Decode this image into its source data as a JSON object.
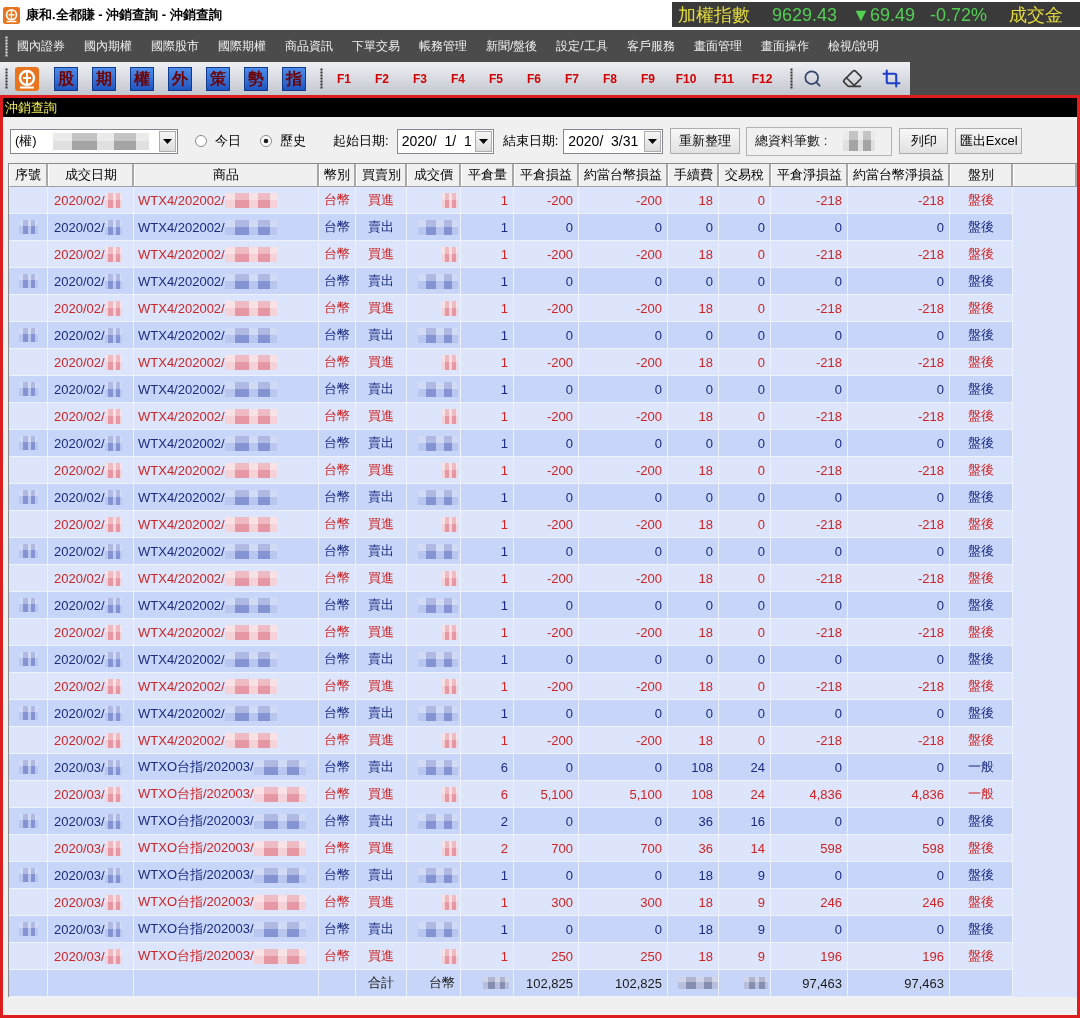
{
  "window": {
    "title": "康和.全都賺 - 沖銷查詢 - 沖銷查詢"
  },
  "ticker": {
    "label": "加權指數",
    "value": "9629.43",
    "change": "▼69.49",
    "percent": "-0.72%",
    "label_2": "成交金"
  },
  "menu": [
    "國內證券",
    "國內期權",
    "國際股市",
    "國際期權",
    "商品資訊",
    "下單交易",
    "帳務管理",
    "新聞/盤後",
    "設定/工具",
    "客戶服務",
    "畫面管理",
    "畫面操作",
    "檢視/說明"
  ],
  "toolbar": {
    "market_buttons": [
      "股",
      "期",
      "權",
      "外",
      "策",
      "勢",
      "指"
    ],
    "function_keys": [
      "F1",
      "F2",
      "F3",
      "F4",
      "F5",
      "F6",
      "F7",
      "F8",
      "F9",
      "F10",
      "F11",
      "F12"
    ]
  },
  "panel": {
    "title": "沖銷查詢"
  },
  "filters": {
    "account": "(權)",
    "range": [
      {
        "label": "今日",
        "selected": false
      },
      {
        "label": "歷史",
        "selected": true
      }
    ],
    "start_label": "起始日期:",
    "start_date": "2020/  1/  1",
    "end_label": "結束日期:",
    "end_date": "2020/  3/31",
    "refresh": "重新整理",
    "count_label": "總資料筆數 :",
    "buttons": [
      "列印",
      "匯出Excel"
    ]
  },
  "table": {
    "columns": [
      "序號",
      "成交日期",
      "商品",
      "幣別",
      "買賣別",
      "成交價",
      "平倉量",
      "平倉損益",
      "約當台幣損益",
      "手續費",
      "交易稅",
      "平倉淨損益",
      "約當台幣淨損益",
      "盤別"
    ],
    "rows": [
      {
        "kind": "buy",
        "seq_blurred": false,
        "date": "2020/02/",
        "product": "WTX4/202002/",
        "currency": "台幣",
        "side": "買進",
        "qty": "1",
        "pnl": "-200",
        "pnl_twd": "-200",
        "fee": "18",
        "tax": "0",
        "net": "-218",
        "net_twd": "-218",
        "session": "盤後"
      },
      {
        "kind": "sell",
        "seq_blurred": true,
        "date": "2020/02/",
        "product": "WTX4/202002/",
        "currency": "台幣",
        "side": "賣出",
        "qty": "1",
        "pnl": "0",
        "pnl_twd": "0",
        "fee": "0",
        "tax": "0",
        "net": "0",
        "net_twd": "0",
        "session": "盤後"
      },
      {
        "kind": "buy",
        "seq_blurred": false,
        "date": "2020/02/",
        "product": "WTX4/202002/",
        "currency": "台幣",
        "side": "買進",
        "qty": "1",
        "pnl": "-200",
        "pnl_twd": "-200",
        "fee": "18",
        "tax": "0",
        "net": "-218",
        "net_twd": "-218",
        "session": "盤後"
      },
      {
        "kind": "sell",
        "seq_blurred": true,
        "date": "2020/02/",
        "product": "WTX4/202002/",
        "currency": "台幣",
        "side": "賣出",
        "qty": "1",
        "pnl": "0",
        "pnl_twd": "0",
        "fee": "0",
        "tax": "0",
        "net": "0",
        "net_twd": "0",
        "session": "盤後"
      },
      {
        "kind": "buy",
        "seq_blurred": false,
        "date": "2020/02/",
        "product": "WTX4/202002/",
        "currency": "台幣",
        "side": "買進",
        "qty": "1",
        "pnl": "-200",
        "pnl_twd": "-200",
        "fee": "18",
        "tax": "0",
        "net": "-218",
        "net_twd": "-218",
        "session": "盤後"
      },
      {
        "kind": "sell",
        "seq_blurred": true,
        "date": "2020/02/",
        "product": "WTX4/202002/",
        "currency": "台幣",
        "side": "賣出",
        "qty": "1",
        "pnl": "0",
        "pnl_twd": "0",
        "fee": "0",
        "tax": "0",
        "net": "0",
        "net_twd": "0",
        "session": "盤後"
      },
      {
        "kind": "buy",
        "seq_blurred": false,
        "date": "2020/02/",
        "product": "WTX4/202002/",
        "currency": "台幣",
        "side": "買進",
        "qty": "1",
        "pnl": "-200",
        "pnl_twd": "-200",
        "fee": "18",
        "tax": "0",
        "net": "-218",
        "net_twd": "-218",
        "session": "盤後"
      },
      {
        "kind": "sell",
        "seq_blurred": true,
        "date": "2020/02/",
        "product": "WTX4/202002/",
        "currency": "台幣",
        "side": "賣出",
        "qty": "1",
        "pnl": "0",
        "pnl_twd": "0",
        "fee": "0",
        "tax": "0",
        "net": "0",
        "net_twd": "0",
        "session": "盤後"
      },
      {
        "kind": "buy",
        "seq_blurred": false,
        "date": "2020/02/",
        "product": "WTX4/202002/",
        "currency": "台幣",
        "side": "買進",
        "qty": "1",
        "pnl": "-200",
        "pnl_twd": "-200",
        "fee": "18",
        "tax": "0",
        "net": "-218",
        "net_twd": "-218",
        "session": "盤後"
      },
      {
        "kind": "sell",
        "seq_blurred": true,
        "date": "2020/02/",
        "product": "WTX4/202002/",
        "currency": "台幣",
        "side": "賣出",
        "qty": "1",
        "pnl": "0",
        "pnl_twd": "0",
        "fee": "0",
        "tax": "0",
        "net": "0",
        "net_twd": "0",
        "session": "盤後"
      },
      {
        "kind": "buy",
        "seq_blurred": false,
        "date": "2020/02/",
        "product": "WTX4/202002/",
        "currency": "台幣",
        "side": "買進",
        "qty": "1",
        "pnl": "-200",
        "pnl_twd": "-200",
        "fee": "18",
        "tax": "0",
        "net": "-218",
        "net_twd": "-218",
        "session": "盤後"
      },
      {
        "kind": "sell",
        "seq_blurred": true,
        "date": "2020/02/",
        "product": "WTX4/202002/",
        "currency": "台幣",
        "side": "賣出",
        "qty": "1",
        "pnl": "0",
        "pnl_twd": "0",
        "fee": "0",
        "tax": "0",
        "net": "0",
        "net_twd": "0",
        "session": "盤後"
      },
      {
        "kind": "buy",
        "seq_blurred": false,
        "date": "2020/02/",
        "product": "WTX4/202002/",
        "currency": "台幣",
        "side": "買進",
        "qty": "1",
        "pnl": "-200",
        "pnl_twd": "-200",
        "fee": "18",
        "tax": "0",
        "net": "-218",
        "net_twd": "-218",
        "session": "盤後"
      },
      {
        "kind": "sell",
        "seq_blurred": true,
        "date": "2020/02/",
        "product": "WTX4/202002/",
        "currency": "台幣",
        "side": "賣出",
        "qty": "1",
        "pnl": "0",
        "pnl_twd": "0",
        "fee": "0",
        "tax": "0",
        "net": "0",
        "net_twd": "0",
        "session": "盤後"
      },
      {
        "kind": "buy",
        "seq_blurred": false,
        "date": "2020/02/",
        "product": "WTX4/202002/",
        "currency": "台幣",
        "side": "買進",
        "qty": "1",
        "pnl": "-200",
        "pnl_twd": "-200",
        "fee": "18",
        "tax": "0",
        "net": "-218",
        "net_twd": "-218",
        "session": "盤後"
      },
      {
        "kind": "sell",
        "seq_blurred": true,
        "date": "2020/02/",
        "product": "WTX4/202002/",
        "currency": "台幣",
        "side": "賣出",
        "qty": "1",
        "pnl": "0",
        "pnl_twd": "0",
        "fee": "0",
        "tax": "0",
        "net": "0",
        "net_twd": "0",
        "session": "盤後"
      },
      {
        "kind": "buy",
        "seq_blurred": false,
        "date": "2020/02/",
        "product": "WTX4/202002/",
        "currency": "台幣",
        "side": "買進",
        "qty": "1",
        "pnl": "-200",
        "pnl_twd": "-200",
        "fee": "18",
        "tax": "0",
        "net": "-218",
        "net_twd": "-218",
        "session": "盤後"
      },
      {
        "kind": "sell",
        "seq_blurred": true,
        "date": "2020/02/",
        "product": "WTX4/202002/",
        "currency": "台幣",
        "side": "賣出",
        "qty": "1",
        "pnl": "0",
        "pnl_twd": "0",
        "fee": "0",
        "tax": "0",
        "net": "0",
        "net_twd": "0",
        "session": "盤後"
      },
      {
        "kind": "buy",
        "seq_blurred": false,
        "date": "2020/02/",
        "product": "WTX4/202002/",
        "currency": "台幣",
        "side": "買進",
        "qty": "1",
        "pnl": "-200",
        "pnl_twd": "-200",
        "fee": "18",
        "tax": "0",
        "net": "-218",
        "net_twd": "-218",
        "session": "盤後"
      },
      {
        "kind": "sell",
        "seq_blurred": true,
        "date": "2020/02/",
        "product": "WTX4/202002/",
        "currency": "台幣",
        "side": "賣出",
        "qty": "1",
        "pnl": "0",
        "pnl_twd": "0",
        "fee": "0",
        "tax": "0",
        "net": "0",
        "net_twd": "0",
        "session": "盤後"
      },
      {
        "kind": "buy",
        "seq_blurred": false,
        "date": "2020/02/",
        "product": "WTX4/202002/",
        "currency": "台幣",
        "side": "買進",
        "qty": "1",
        "pnl": "-200",
        "pnl_twd": "-200",
        "fee": "18",
        "tax": "0",
        "net": "-218",
        "net_twd": "-218",
        "session": "盤後"
      },
      {
        "kind": "sell",
        "seq_blurred": true,
        "date": "2020/03/",
        "product": "WTXO台指/202003/",
        "currency": "台幣",
        "side": "賣出",
        "qty": "6",
        "pnl": "0",
        "pnl_twd": "0",
        "fee": "108",
        "tax": "24",
        "net": "0",
        "net_twd": "0",
        "session": "一般"
      },
      {
        "kind": "buy",
        "seq_blurred": false,
        "date": "2020/03/",
        "product": "WTXO台指/202003/",
        "currency": "台幣",
        "side": "買進",
        "qty": "6",
        "pnl": "5,100",
        "pnl_twd": "5,100",
        "fee": "108",
        "tax": "24",
        "net": "4,836",
        "net_twd": "4,836",
        "session": "一般"
      },
      {
        "kind": "sell",
        "seq_blurred": true,
        "date": "2020/03/",
        "product": "WTXO台指/202003/",
        "currency": "台幣",
        "side": "賣出",
        "qty": "2",
        "pnl": "0",
        "pnl_twd": "0",
        "fee": "36",
        "tax": "16",
        "net": "0",
        "net_twd": "0",
        "session": "盤後"
      },
      {
        "kind": "buy",
        "seq_blurred": false,
        "date": "2020/03/",
        "product": "WTXO台指/202003/",
        "currency": "台幣",
        "side": "買進",
        "qty": "2",
        "pnl": "700",
        "pnl_twd": "700",
        "fee": "36",
        "tax": "14",
        "net": "598",
        "net_twd": "598",
        "session": "盤後"
      },
      {
        "kind": "sell",
        "seq_blurred": true,
        "date": "2020/03/",
        "product": "WTXO台指/202003/",
        "currency": "台幣",
        "side": "賣出",
        "qty": "1",
        "pnl": "0",
        "pnl_twd": "0",
        "fee": "18",
        "tax": "9",
        "net": "0",
        "net_twd": "0",
        "session": "盤後"
      },
      {
        "kind": "buy",
        "seq_blurred": false,
        "date": "2020/03/",
        "product": "WTXO台指/202003/",
        "currency": "台幣",
        "side": "買進",
        "qty": "1",
        "pnl": "300",
        "pnl_twd": "300",
        "fee": "18",
        "tax": "9",
        "net": "246",
        "net_twd": "246",
        "session": "盤後"
      },
      {
        "kind": "sell",
        "seq_blurred": true,
        "date": "2020/03/",
        "product": "WTXO台指/202003/",
        "currency": "台幣",
        "side": "賣出",
        "qty": "1",
        "pnl": "0",
        "pnl_twd": "0",
        "fee": "18",
        "tax": "9",
        "net": "0",
        "net_twd": "0",
        "session": "盤後"
      },
      {
        "kind": "buy",
        "seq_blurred": false,
        "date": "2020/03/",
        "product": "WTXO台指/202003/",
        "currency": "台幣",
        "side": "買進",
        "qty": "1",
        "pnl": "250",
        "pnl_twd": "250",
        "fee": "18",
        "tax": "9",
        "net": "196",
        "net_twd": "196",
        "session": "盤後"
      }
    ],
    "totals": {
      "label": "合計",
      "currency": "台幣",
      "pnl": "102,825",
      "pnl_twd": "102,825",
      "net": "97,463",
      "net_twd": "97,463"
    }
  }
}
